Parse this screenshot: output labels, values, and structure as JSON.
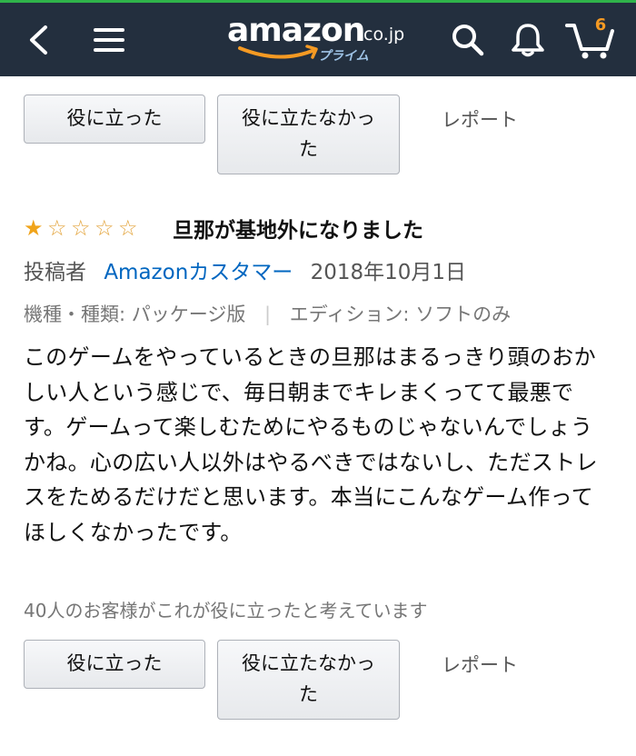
{
  "header": {
    "logo_text": "amazon",
    "logo_domain": ".co.jp",
    "logo_sub": "プライム",
    "cart_count": "6",
    "background": "#232f3e"
  },
  "top_actions": {
    "helpful_label": "役に立った",
    "not_helpful_label": "役に立たなかった",
    "report_label": "レポート"
  },
  "review": {
    "rating": 1,
    "rating_max": 5,
    "title": "旦那が基地外になりました",
    "posted_by_label": "投稿者",
    "author": "Amazonカスタマー",
    "date": "2018年10月1日",
    "variant_label": "機種・種類: パッケージ版",
    "edition_label": "エディション: ソフトのみ",
    "body": "このゲームをやっているときの旦那はまるっきり頭のおかしい人という感じで、毎日朝までキレまくってて最悪です。ゲームって楽しむためにやるものじゃないんでしょうかね。心の広い人以外はやるべきではないし、ただストレスをためるだけだと思います。本当にこんなゲーム作ってほしくなかったです。",
    "helpful_count_text": "40人のお客様がこれが役に立ったと考えています"
  },
  "bottom_actions": {
    "helpful_label": "役に立った",
    "not_helpful_label": "役に立たなかった",
    "report_label": "レポート"
  },
  "colors": {
    "star": "#f0a41b",
    "link": "#0066c0",
    "cart_badge": "#f59a23"
  },
  "icons": [
    "back-arrow-icon",
    "hamburger-menu-icon",
    "search-icon",
    "bell-icon",
    "cart-icon"
  ]
}
